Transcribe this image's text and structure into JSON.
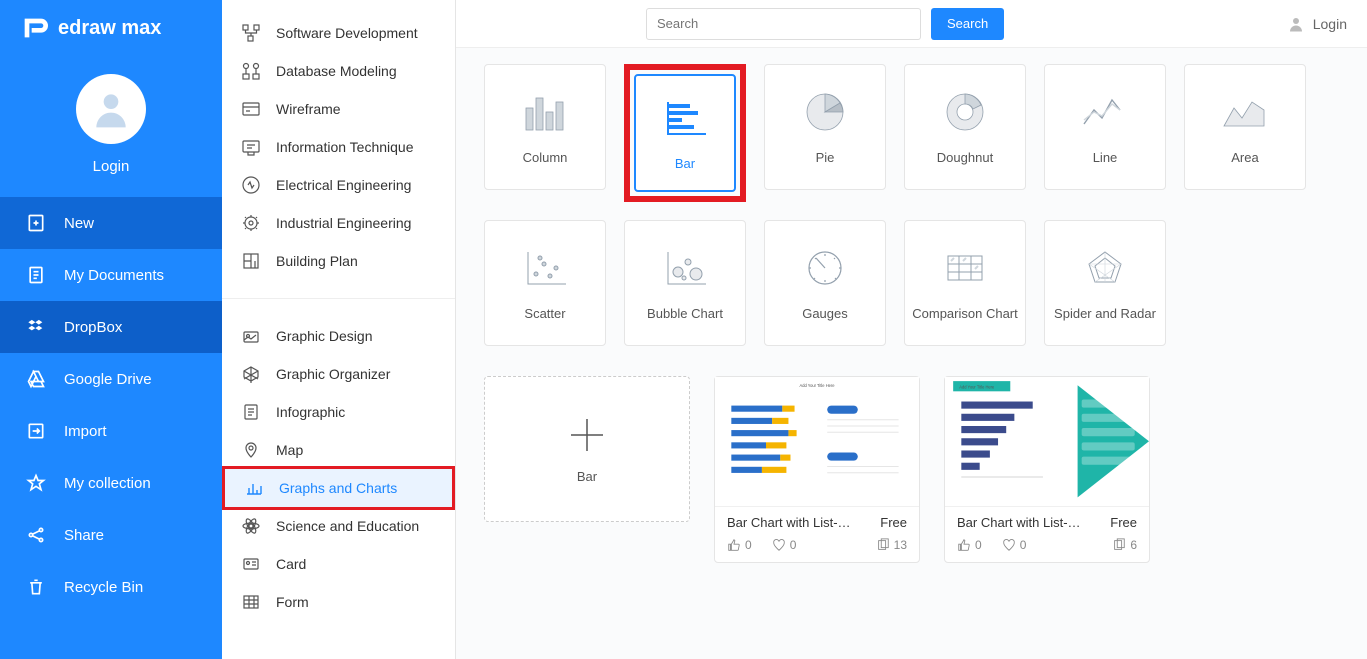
{
  "app": {
    "name": "edraw max"
  },
  "header": {
    "search_placeholder": "Search",
    "search_button": "Search",
    "login": "Login"
  },
  "sidebar": {
    "avatar_label": "Login",
    "items": [
      {
        "label": "New",
        "icon": "plus-file-icon",
        "state": "active"
      },
      {
        "label": "My Documents",
        "icon": "document-icon",
        "state": ""
      },
      {
        "label": "DropBox",
        "icon": "dropbox-icon",
        "state": "dark"
      },
      {
        "label": "Google Drive",
        "icon": "google-drive-icon",
        "state": ""
      },
      {
        "label": "Import",
        "icon": "import-icon",
        "state": ""
      },
      {
        "label": "My collection",
        "icon": "star-icon",
        "state": ""
      },
      {
        "label": "Share",
        "icon": "share-icon",
        "state": ""
      },
      {
        "label": "Recycle Bin",
        "icon": "trash-icon",
        "state": ""
      }
    ]
  },
  "categories": {
    "group1": [
      {
        "label": "Software Development"
      },
      {
        "label": "Database Modeling"
      },
      {
        "label": "Wireframe"
      },
      {
        "label": "Information Technique"
      },
      {
        "label": "Electrical Engineering"
      },
      {
        "label": "Industrial Engineering"
      },
      {
        "label": "Building Plan"
      }
    ],
    "group2": [
      {
        "label": "Graphic Design"
      },
      {
        "label": "Graphic Organizer"
      },
      {
        "label": "Infographic"
      },
      {
        "label": "Map"
      },
      {
        "label": "Graphs and Charts",
        "selected": true
      },
      {
        "label": "Science and Education"
      },
      {
        "label": "Card"
      },
      {
        "label": "Form"
      }
    ]
  },
  "chart_types": [
    {
      "label": "Column"
    },
    {
      "label": "Bar",
      "selected": true
    },
    {
      "label": "Pie"
    },
    {
      "label": "Doughnut"
    },
    {
      "label": "Line"
    },
    {
      "label": "Area"
    },
    {
      "label": "Scatter"
    },
    {
      "label": "Bubble Chart"
    },
    {
      "label": "Gauges"
    },
    {
      "label": "Comparison Chart"
    },
    {
      "label": "Spider and Radar"
    }
  ],
  "templates": {
    "new_label": "Bar",
    "items": [
      {
        "name": "Bar Chart with List-Pa...",
        "price": "Free",
        "likes": "0",
        "hearts": "0",
        "copies": "13"
      },
      {
        "name": "Bar Chart with List-A...",
        "price": "Free",
        "likes": "0",
        "hearts": "0",
        "copies": "6"
      }
    ]
  }
}
